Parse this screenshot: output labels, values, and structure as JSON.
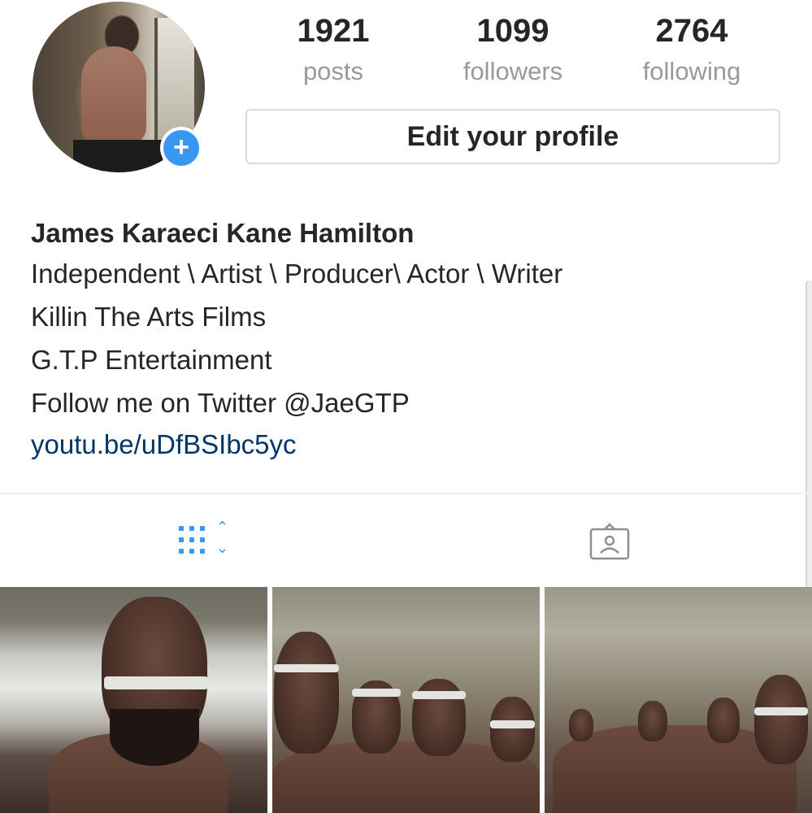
{
  "profile": {
    "stats": [
      {
        "value": "1921",
        "label": "posts"
      },
      {
        "value": "1099",
        "label": "followers"
      },
      {
        "value": "2764",
        "label": "following"
      }
    ],
    "edit_label": "Edit your profile",
    "add_symbol": "+"
  },
  "bio": {
    "name": "James Karaeci Kane Hamilton",
    "lines": [
      "Independent \\ Artist \\ Producer\\ Actor \\ Writer",
      "Killin The Arts Films",
      "G.T.P Entertainment",
      "Follow me on Twitter @JaeGTP"
    ],
    "link": "youtu.be/uDfBSIbc5yc"
  },
  "tabs": {
    "grid_icon": "grid-view-icon",
    "tagged_icon": "tagged-photos-icon",
    "active_color": "#3897f0"
  },
  "colors": {
    "accent": "#3897f0",
    "link": "#003569",
    "muted": "#999999",
    "text": "#262626"
  }
}
